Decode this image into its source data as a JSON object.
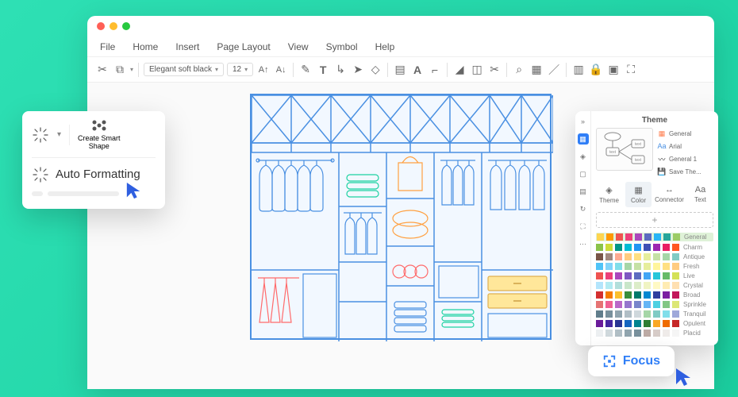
{
  "menubar": [
    "File",
    "Home",
    "Insert",
    "Page Layout",
    "View",
    "Symbol",
    "Help"
  ],
  "toolbar": {
    "font_family": "Elegant soft black",
    "font_size": "12"
  },
  "popup_af": {
    "smart_label1": "Create Smart",
    "smart_label2": "Shape",
    "auto_formatting": "Auto Formatting"
  },
  "theme": {
    "title": "Theme",
    "preview_items": [
      {
        "label": "General",
        "color": "#ff7f50"
      },
      {
        "label": "Arial",
        "color": "#4a90e2"
      },
      {
        "label": "General 1",
        "color": "#333"
      },
      {
        "label": "Save The...",
        "color": "#888"
      }
    ],
    "tabs": [
      "Theme",
      "Color",
      "Connector",
      "Text"
    ],
    "active_tab": 1,
    "palettes": [
      {
        "name": "General",
        "selected": true,
        "colors": [
          "#ffd54f",
          "#ff9800",
          "#ef5350",
          "#ec407a",
          "#ab47bc",
          "#5c6bc0",
          "#29b6f6",
          "#26a69a",
          "#9ccc65"
        ]
      },
      {
        "name": "Charm",
        "colors": [
          "#8bc34a",
          "#cddc39",
          "#009688",
          "#00bcd4",
          "#2196f3",
          "#3f51b5",
          "#9c27b0",
          "#e91e63",
          "#ff5722"
        ]
      },
      {
        "name": "Antique",
        "colors": [
          "#795548",
          "#a1887f",
          "#ffab91",
          "#ffcc80",
          "#ffe082",
          "#e6ee9c",
          "#c5e1a5",
          "#a5d6a7",
          "#80cbc4"
        ]
      },
      {
        "name": "Fresh",
        "colors": [
          "#4fc3f7",
          "#81d4fa",
          "#80deea",
          "#a5d6a7",
          "#c5e1a5",
          "#e6ee9c",
          "#fff59d",
          "#ffe082",
          "#ffcc80"
        ]
      },
      {
        "name": "Live",
        "colors": [
          "#ef5350",
          "#ec407a",
          "#ab47bc",
          "#7e57c2",
          "#5c6bc0",
          "#42a5f5",
          "#26c6da",
          "#66bb6a",
          "#d4e157"
        ]
      },
      {
        "name": "Crystal",
        "colors": [
          "#b3e5fc",
          "#b2ebf2",
          "#b2dfdb",
          "#c8e6c9",
          "#dcedc8",
          "#f0f4c3",
          "#fff9c4",
          "#ffecb3",
          "#ffe0b2"
        ]
      },
      {
        "name": "Broad",
        "colors": [
          "#d32f2f",
          "#f57c00",
          "#fbc02d",
          "#388e3c",
          "#00796b",
          "#0288d1",
          "#303f9f",
          "#7b1fa2",
          "#c2185b"
        ]
      },
      {
        "name": "Sprinkle",
        "colors": [
          "#e57373",
          "#f06292",
          "#ba68c8",
          "#9575cd",
          "#7986cb",
          "#64b5f6",
          "#4dd0e1",
          "#81c784",
          "#dce775"
        ]
      },
      {
        "name": "Tranquil",
        "colors": [
          "#607d8b",
          "#78909c",
          "#90a4ae",
          "#b0bec5",
          "#cfd8dc",
          "#a5d6a7",
          "#80cbc4",
          "#80deea",
          "#9fa8da"
        ]
      },
      {
        "name": "Opulent",
        "colors": [
          "#6a1b9a",
          "#4527a0",
          "#283593",
          "#1565c0",
          "#00838f",
          "#2e7d32",
          "#f9a825",
          "#ef6c00",
          "#c62828"
        ]
      },
      {
        "name": "Placid",
        "colors": [
          "#eceff1",
          "#cfd8dc",
          "#b0bec5",
          "#90a4ae",
          "#78909c",
          "#bcaaa4",
          "#d7ccc8",
          "#efebe9",
          "#f5f5f5"
        ]
      }
    ]
  },
  "focus": {
    "label": "Focus"
  }
}
